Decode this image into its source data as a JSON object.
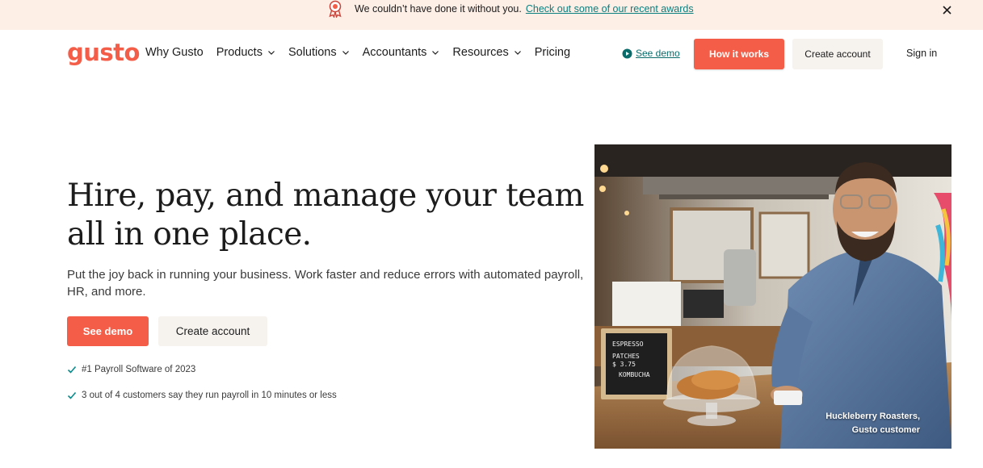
{
  "banner": {
    "text": "We couldn’t have done it without you.",
    "link": "Check out some of our recent awards",
    "icons": {
      "award": "award-ribbon-icon",
      "close": "close-icon"
    }
  },
  "nav": {
    "logo": "gusto",
    "links": [
      {
        "label": "Why Gusto",
        "dropdown": false
      },
      {
        "label": "Products",
        "dropdown": true
      },
      {
        "label": "Solutions",
        "dropdown": true
      },
      {
        "label": "Accountants",
        "dropdown": true
      },
      {
        "label": "Resources",
        "dropdown": true
      },
      {
        "label": "Pricing",
        "dropdown": false
      }
    ],
    "see_demo": "See demo",
    "how_it_works": "How it works",
    "create_account": "Create account",
    "sign_in": "Sign in"
  },
  "hero": {
    "title": "Hire, pay, and manage your team all in one place.",
    "subtitle": "Put the joy back in running your business. Work faster and reduce errors with automated payroll, HR, and more.",
    "primary_cta": "See demo",
    "secondary_cta": "Create account",
    "checks": [
      "#1 Payroll Software of 2023",
      "3 out of 4 customers say they run payroll in 10 minutes or less"
    ]
  },
  "photo": {
    "caption_line1": "Huckleberry Roasters,",
    "caption_line2": "Gusto customer",
    "sign_lines": [
      "ESPRESSO",
      "PATCHES",
      "$ 3.75",
      "KOMBUCHA"
    ]
  },
  "colors": {
    "brand": "#f45d48",
    "banner_bg": "#fdeee6",
    "link_teal": "#0a8080",
    "check_teal": "#0a8a8a",
    "secondary_btn": "#f6f3ef"
  }
}
